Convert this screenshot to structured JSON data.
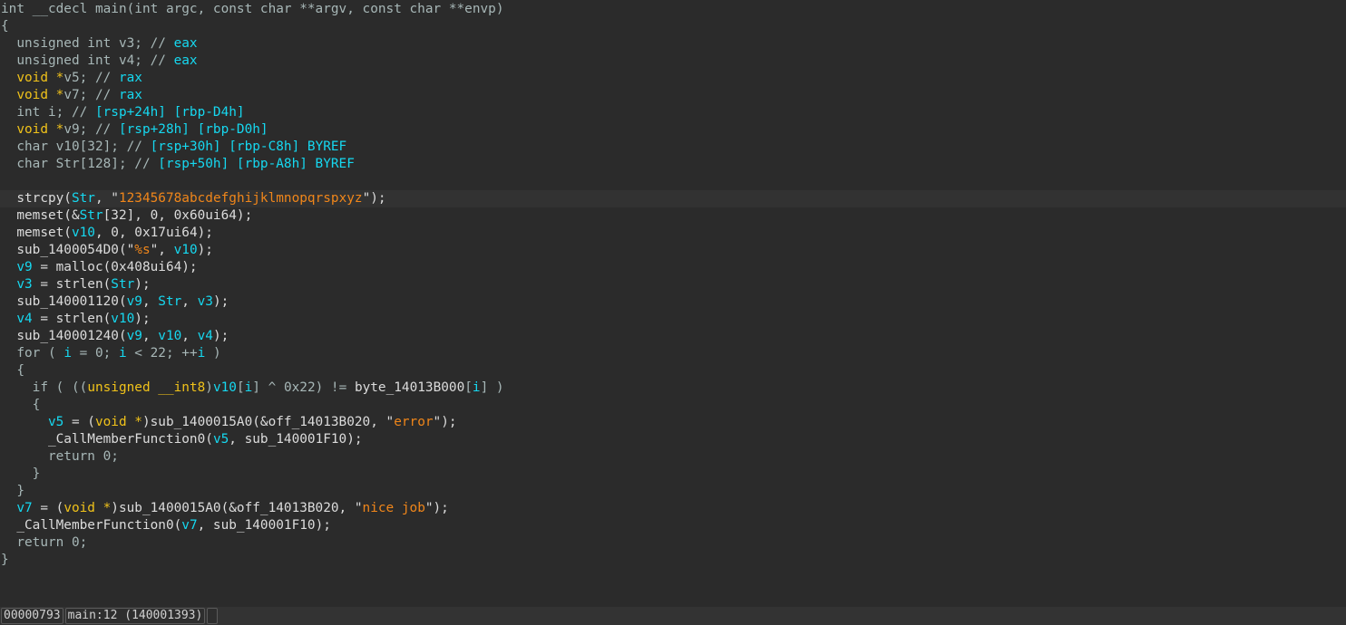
{
  "pseudocode": {
    "current_line": 11,
    "lines": [
      [
        [
          "k",
          "int __cdecl main(int argc, const char **argv, const char **envp)"
        ]
      ],
      [
        [
          "k",
          "{"
        ]
      ],
      [
        [
          "k",
          "  unsigned int v3; // "
        ],
        [
          "v",
          "eax"
        ]
      ],
      [
        [
          "k",
          "  unsigned int v4; // "
        ],
        [
          "v",
          "eax"
        ]
      ],
      [
        [
          "k",
          "  "
        ],
        [
          "t",
          "void *"
        ],
        [
          "k",
          "v5; // "
        ],
        [
          "v",
          "rax"
        ]
      ],
      [
        [
          "k",
          "  "
        ],
        [
          "t",
          "void *"
        ],
        [
          "k",
          "v7; // "
        ],
        [
          "v",
          "rax"
        ]
      ],
      [
        [
          "k",
          "  int i; // "
        ],
        [
          "v",
          "[rsp+24h] [rbp-D4h]"
        ]
      ],
      [
        [
          "k",
          "  "
        ],
        [
          "t",
          "void *"
        ],
        [
          "k",
          "v9; // "
        ],
        [
          "v",
          "[rsp+28h] [rbp-D0h]"
        ]
      ],
      [
        [
          "k",
          "  char v10[32]; // "
        ],
        [
          "v",
          "[rsp+30h] [rbp-C8h] BYREF"
        ]
      ],
      [
        [
          "k",
          "  char Str[128]; // "
        ],
        [
          "v",
          "[rsp+50h] [rbp-A8h] BYREF"
        ]
      ],
      [],
      [
        [
          "d",
          "  strcpy("
        ],
        [
          "v",
          "Str"
        ],
        [
          "d",
          ", \""
        ],
        [
          "s",
          "12345678abcdefghijklmnopqrspxyz"
        ],
        [
          "d",
          "\");"
        ]
      ],
      [
        [
          "d",
          "  memset(&"
        ],
        [
          "v",
          "Str"
        ],
        [
          "d",
          "[32], 0, 0x60ui64);"
        ]
      ],
      [
        [
          "d",
          "  memset("
        ],
        [
          "v",
          "v10"
        ],
        [
          "d",
          ", 0, 0x17ui64);"
        ]
      ],
      [
        [
          "d",
          "  sub_1400054D0(\""
        ],
        [
          "s",
          "%s"
        ],
        [
          "d",
          "\", "
        ],
        [
          "v",
          "v10"
        ],
        [
          "d",
          ");"
        ]
      ],
      [
        [
          "d",
          "  "
        ],
        [
          "v",
          "v9"
        ],
        [
          "d",
          " = malloc(0x408ui64);"
        ]
      ],
      [
        [
          "d",
          "  "
        ],
        [
          "v",
          "v3"
        ],
        [
          "d",
          " = strlen("
        ],
        [
          "v",
          "Str"
        ],
        [
          "d",
          ");"
        ]
      ],
      [
        [
          "d",
          "  sub_140001120("
        ],
        [
          "v",
          "v9"
        ],
        [
          "d",
          ", "
        ],
        [
          "v",
          "Str"
        ],
        [
          "d",
          ", "
        ],
        [
          "v",
          "v3"
        ],
        [
          "d",
          ");"
        ]
      ],
      [
        [
          "d",
          "  "
        ],
        [
          "v",
          "v4"
        ],
        [
          "d",
          " = strlen("
        ],
        [
          "v",
          "v10"
        ],
        [
          "d",
          ");"
        ]
      ],
      [
        [
          "d",
          "  sub_140001240("
        ],
        [
          "v",
          "v9"
        ],
        [
          "d",
          ", "
        ],
        [
          "v",
          "v10"
        ],
        [
          "d",
          ", "
        ],
        [
          "v",
          "v4"
        ],
        [
          "d",
          ");"
        ]
      ],
      [
        [
          "k",
          "  for ( "
        ],
        [
          "v",
          "i"
        ],
        [
          "k",
          " = 0; "
        ],
        [
          "v",
          "i"
        ],
        [
          "k",
          " < 22; ++"
        ],
        [
          "v",
          "i"
        ],
        [
          "k",
          " )"
        ]
      ],
      [
        [
          "k",
          "  {"
        ]
      ],
      [
        [
          "k",
          "    if ( (("
        ],
        [
          "t",
          "unsigned __int8"
        ],
        [
          "k",
          ")"
        ],
        [
          "v",
          "v10"
        ],
        [
          "k",
          "["
        ],
        [
          "v",
          "i"
        ],
        [
          "k",
          "] ^ 0x22) != "
        ],
        [
          "d",
          "byte_14013B000"
        ],
        [
          "k",
          "["
        ],
        [
          "v",
          "i"
        ],
        [
          "k",
          "] )"
        ]
      ],
      [
        [
          "k",
          "    {"
        ]
      ],
      [
        [
          "d",
          "      "
        ],
        [
          "v",
          "v5"
        ],
        [
          "d",
          " = ("
        ],
        [
          "t",
          "void *"
        ],
        [
          "d",
          ")sub_1400015A0(&off_14013B020, \""
        ],
        [
          "s",
          "error"
        ],
        [
          "d",
          "\");"
        ]
      ],
      [
        [
          "d",
          "      _CallMemberFunction0("
        ],
        [
          "v",
          "v5"
        ],
        [
          "d",
          ", sub_140001F10);"
        ]
      ],
      [
        [
          "k",
          "      return 0;"
        ]
      ],
      [
        [
          "k",
          "    }"
        ]
      ],
      [
        [
          "k",
          "  }"
        ]
      ],
      [
        [
          "d",
          "  "
        ],
        [
          "v",
          "v7"
        ],
        [
          "d",
          " = ("
        ],
        [
          "t",
          "void *"
        ],
        [
          "d",
          ")sub_1400015A0(&off_14013B020, \""
        ],
        [
          "s",
          "nice job"
        ],
        [
          "d",
          "\");"
        ]
      ],
      [
        [
          "d",
          "  _CallMemberFunction0("
        ],
        [
          "v",
          "v7"
        ],
        [
          "d",
          ", sub_140001F10);"
        ]
      ],
      [
        [
          "k",
          "  return 0;"
        ]
      ],
      [
        [
          "k",
          "}"
        ]
      ]
    ]
  },
  "status_bar": {
    "offset": "00000793",
    "location": "main:12 (140001393)"
  },
  "colors": {
    "background": "#2b2b2b",
    "keyword": "#a7b7b7",
    "text": "#dcdcdc",
    "variable": "#16d8f0",
    "type": "#f0c21a",
    "string": "#f0861a"
  }
}
